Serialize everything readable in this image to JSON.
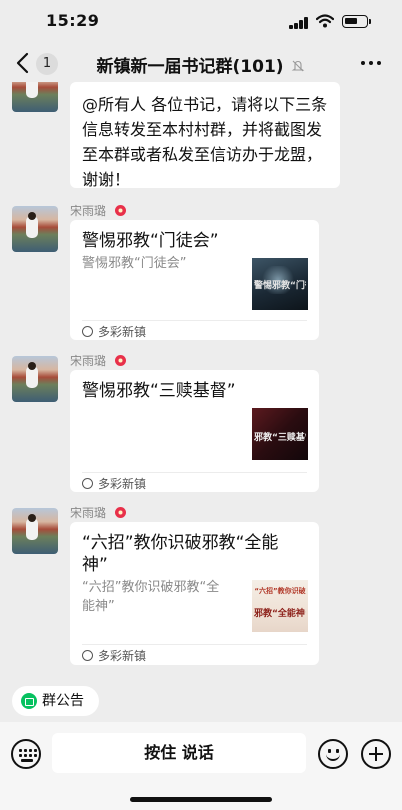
{
  "status_bar": {
    "time": "15:29"
  },
  "nav": {
    "unread_count": "1",
    "title": "新镇新一届书记群(101)",
    "icons": {
      "back": "chevron-left-icon",
      "mute": "bell-slash-icon",
      "more": "more-horizontal-icon"
    }
  },
  "messages": [
    {
      "type": "text",
      "text": "@所有人 各位书记，请将以下三条信息转发至本村村群，并将截图发至本群或者私发至信访办于龙盟，谢谢！"
    },
    {
      "type": "card",
      "sender": "宋雨璐",
      "title": "警惕邪教“门徒会”",
      "description": "警惕邪教“门徒会”",
      "thumb_text": "警惕邪教“门徒会”",
      "source": "多彩新镇"
    },
    {
      "type": "card",
      "sender": "宋雨璐",
      "title": "警惕邪教“三赎基督”",
      "description": "",
      "thumb_text": "邪教“三赎基督”",
      "source": "多彩新镇"
    },
    {
      "type": "card",
      "sender": "宋雨璐",
      "title": "“六招”教你识破邪教“全能神”",
      "description": "“六招”教你识破邪教“全能神”",
      "thumb_text": "邪教“全能神”",
      "thumb_caption": "“六招”教你识破",
      "source": "多彩新镇"
    }
  ],
  "notice_chip": {
    "label": "群公告"
  },
  "input_bar": {
    "hold_to_talk": "按住 说话",
    "icons": {
      "keyboard": "keyboard-icon",
      "emoji": "emoji-icon",
      "plus": "plus-icon"
    }
  },
  "colors": {
    "background": "#ededed",
    "bubble": "#ffffff",
    "notice_green": "#07c160",
    "sender_gray": "#888888"
  }
}
